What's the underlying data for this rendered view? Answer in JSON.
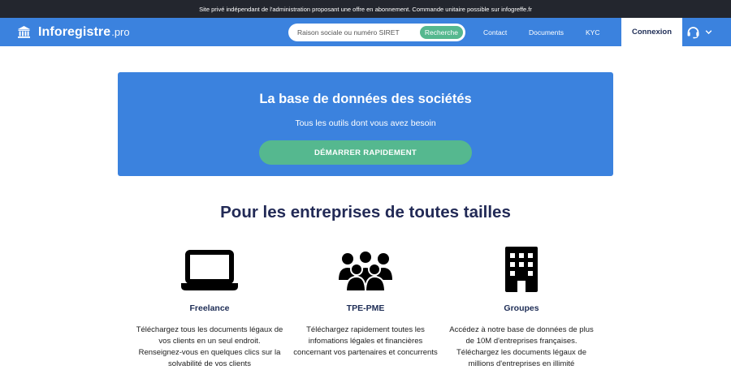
{
  "topbar": {
    "text": "Site privé indépendant de l'administration proposant une offre en abonnement. Commande unitaire possible sur infogreffe.fr"
  },
  "header": {
    "logo_name": "Inforegistre",
    "logo_tld": ".pro",
    "search": {
      "placeholder": "Raison sociale ou numéro SIRET",
      "button": "Recherche"
    },
    "nav": {
      "contact": "Contact",
      "documents": "Documents",
      "kyc": "KYC"
    },
    "connexion": "Connexion"
  },
  "hero": {
    "title": "La base de données des sociétés",
    "subtitle": "Tous les outils dont vous avez besoin",
    "cta": "DÉMARRER RAPIDEMENT"
  },
  "section": {
    "title": "Pour les entreprises de toutes tailles"
  },
  "features": [
    {
      "icon": "laptop-icon",
      "title": "Freelance",
      "lines": [
        "Téléchargez tous les documents légaux de",
        "vos clients en un seul endroit.",
        "Renseignez-vous en quelques clics sur la",
        "solvabilité de vos clients"
      ]
    },
    {
      "icon": "users-icon",
      "title": "TPE-PME",
      "lines": [
        "Téléchargez rapidement toutes les",
        "infomations légales et financières",
        "concernant vos partenaires et concurrents"
      ]
    },
    {
      "icon": "building-icon",
      "title": "Groupes",
      "lines": [
        "Accédez à notre base de données de plus",
        "de 10M d'entreprises françaises.",
        "Téléchargez les documents légaux de",
        "millions d'entreprises en illimité"
      ]
    }
  ],
  "colors": {
    "brand_blue": "#3b82de",
    "cta_green": "#55b88f",
    "navy": "#1d2c55",
    "topbar": "#23262e"
  }
}
